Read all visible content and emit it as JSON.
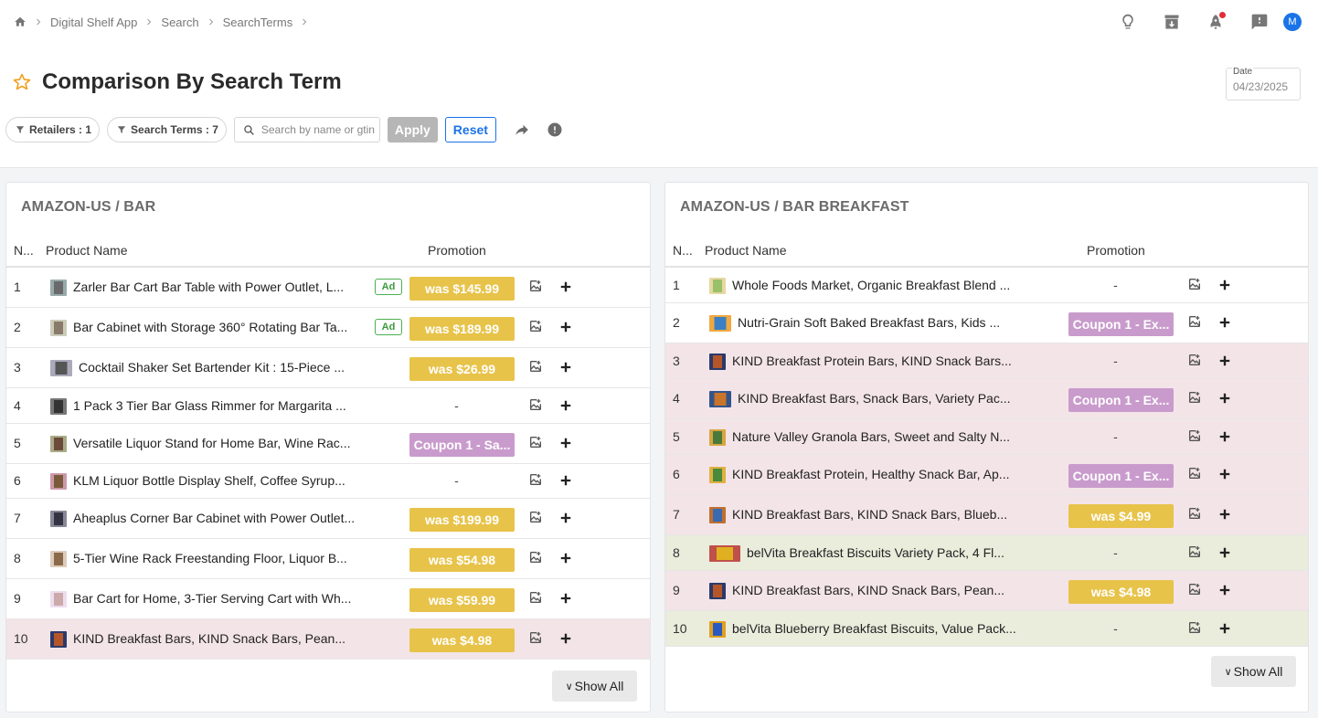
{
  "breadcrumb": {
    "items": [
      "Digital Shelf App",
      "Search",
      "SearchTerms"
    ]
  },
  "user": {
    "initial": "M"
  },
  "page": {
    "title": "Comparison By Search Term"
  },
  "date": {
    "label": "Date",
    "value": "04/23/2025"
  },
  "filters": {
    "retailers": "Retailers : 1",
    "search_terms": "Search Terms : 7",
    "search_placeholder": "Search by name or gtin",
    "apply": "Apply",
    "reset": "Reset"
  },
  "columns": {
    "num": "N...",
    "name": "Product Name",
    "promotion": "Promotion"
  },
  "show_all": "Show All",
  "panels": [
    {
      "title": "AMAZON-US / BAR",
      "rows": [
        {
          "num": "1",
          "name": "Zarler Bar Cart Bar Table with Power Outlet, L...",
          "ad": "Ad",
          "promo": "was $145.99",
          "promo_type": "was",
          "bg": "white",
          "thumb": "cart"
        },
        {
          "num": "2",
          "name": "Bar Cabinet with Storage 360° Rotating Bar Ta...",
          "ad": "Ad",
          "promo": "was $189.99",
          "promo_type": "was",
          "bg": "white",
          "thumb": "cabinet"
        },
        {
          "num": "3",
          "name": "Cocktail Shaker Set Bartender Kit : 15-Piece ...",
          "ad": "",
          "promo": "was $26.99",
          "promo_type": "was",
          "bg": "white",
          "thumb": "shaker"
        },
        {
          "num": "4",
          "name": "1 Pack 3 Tier Bar Glass Rimmer for Margarita ...",
          "ad": "",
          "promo": "-",
          "promo_type": "none",
          "bg": "white",
          "thumb": "rimmer"
        },
        {
          "num": "5",
          "name": "Versatile Liquor Stand for Home Bar, Wine Rac...",
          "ad": "",
          "promo": "Coupon 1 - Sa...",
          "promo_type": "coupon",
          "bg": "white",
          "thumb": "stand"
        },
        {
          "num": "6",
          "name": "KLM Liquor Bottle Display Shelf, Coffee Syrup...",
          "ad": "",
          "promo": "-",
          "promo_type": "none",
          "bg": "white",
          "thumb": "shelf"
        },
        {
          "num": "7",
          "name": "Aheaplus Corner Bar Cabinet with Power Outlet...",
          "ad": "",
          "promo": "was $199.99",
          "promo_type": "was",
          "bg": "white",
          "thumb": "corner"
        },
        {
          "num": "8",
          "name": "5-Tier Wine Rack Freestanding Floor, Liquor B...",
          "ad": "",
          "promo": "was $54.98",
          "promo_type": "was",
          "bg": "white",
          "thumb": "winerack"
        },
        {
          "num": "9",
          "name": "Bar Cart for Home, 3-Tier Serving Cart with Wh...",
          "ad": "",
          "promo": "was $59.99",
          "promo_type": "was",
          "bg": "white",
          "thumb": "cart2"
        },
        {
          "num": "10",
          "name": "KIND Breakfast Bars, KIND Snack Bars, Pean...",
          "ad": "",
          "promo": "was $4.98",
          "promo_type": "was",
          "bg": "pink",
          "thumb": "kind"
        }
      ]
    },
    {
      "title": "AMAZON-US / BAR BREAKFAST",
      "rows": [
        {
          "num": "1",
          "name": "Whole Foods Market, Organic Breakfast Blend ...",
          "ad": "",
          "promo": "-",
          "promo_type": "none",
          "bg": "white",
          "thumb": "wholefoods"
        },
        {
          "num": "2",
          "name": "Nutri-Grain Soft Baked Breakfast Bars, Kids ...",
          "ad": "",
          "promo": "Coupon 1 - Ex...",
          "promo_type": "coupon",
          "bg": "white",
          "thumb": "nutrigrain"
        },
        {
          "num": "3",
          "name": "KIND Breakfast Protein Bars, KIND Snack Bars...",
          "ad": "",
          "promo": "-",
          "promo_type": "none",
          "bg": "pink",
          "thumb": "kind"
        },
        {
          "num": "4",
          "name": "KIND Breakfast Bars, Snack Bars, Variety Pac...",
          "ad": "",
          "promo": "Coupon 1 - Ex...",
          "promo_type": "coupon",
          "bg": "pink",
          "thumb": "kindvar"
        },
        {
          "num": "5",
          "name": "Nature Valley Granola Bars, Sweet and Salty N...",
          "ad": "",
          "promo": "-",
          "promo_type": "none",
          "bg": "pink",
          "thumb": "naturevalley"
        },
        {
          "num": "6",
          "name": "KIND Breakfast Protein, Healthy Snack Bar, Ap...",
          "ad": "",
          "promo": "Coupon 1 - Ex...",
          "promo_type": "coupon",
          "bg": "pink",
          "thumb": "kindgreen"
        },
        {
          "num": "7",
          "name": "KIND Breakfast Bars, KIND Snack Bars, Blueb...",
          "ad": "",
          "promo": "was $4.99",
          "promo_type": "was",
          "bg": "pink",
          "thumb": "kindblue"
        },
        {
          "num": "8",
          "name": "belVita Breakfast Biscuits Variety Pack, 4 Fl...",
          "ad": "",
          "promo": "-",
          "promo_type": "none",
          "bg": "olive",
          "thumb": "belvita"
        },
        {
          "num": "9",
          "name": "KIND Breakfast Bars, KIND Snack Bars, Pean...",
          "ad": "",
          "promo": "was $4.98",
          "promo_type": "was",
          "bg": "pink",
          "thumb": "kind"
        },
        {
          "num": "10",
          "name": "belVita Blueberry Breakfast Biscuits, Value Pack...",
          "ad": "",
          "promo": "-",
          "promo_type": "none",
          "bg": "olive",
          "thumb": "belvitablue"
        }
      ]
    }
  ],
  "colors": {
    "was_promo": "#e8c34a",
    "coupon_promo": "#c99bcc",
    "pink_row": "#f3e4e8",
    "olive_row": "#eaecdc",
    "accent": "#1a73e8",
    "star": "#f0a020"
  }
}
